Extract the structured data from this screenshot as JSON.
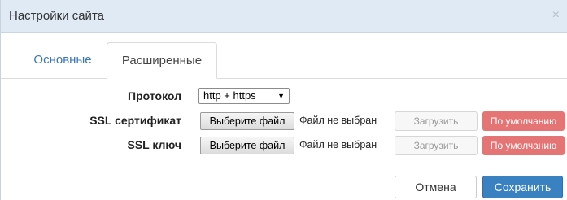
{
  "dialog": {
    "title": "Настройки сайта",
    "close_glyph": "×"
  },
  "tabs": [
    {
      "label": "Основные",
      "active": false
    },
    {
      "label": "Расширенные",
      "active": true
    }
  ],
  "form": {
    "protocol": {
      "label": "Протокол",
      "selected": "http + https",
      "caret": "▼"
    },
    "ssl_cert": {
      "label": "SSL сертификат",
      "file_button": "Выберите файл",
      "file_status": "Файл не выбран",
      "upload_button": "Загрузить",
      "default_button": "По умолчанию"
    },
    "ssl_key": {
      "label": "SSL ключ",
      "file_button": "Выберите файл",
      "file_status": "Файл не выбран",
      "upload_button": "Загрузить",
      "default_button": "По умолчанию"
    }
  },
  "footer": {
    "cancel": "Отмена",
    "save": "Сохранить"
  },
  "colors": {
    "titlebar": "#dfeaf4",
    "link": "#3a77b4",
    "danger": "#e57474",
    "primary": "#3a81c2"
  }
}
